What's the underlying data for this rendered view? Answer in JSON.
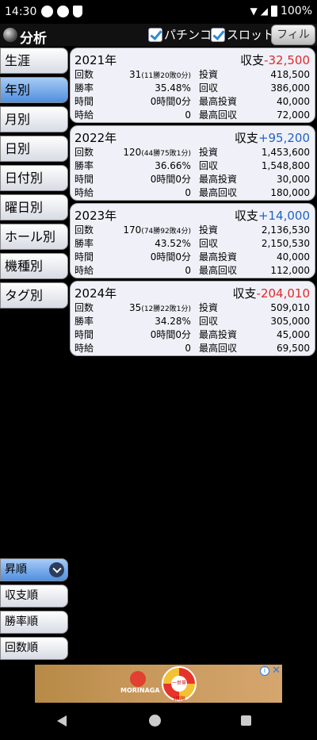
{
  "status": {
    "time": "14:30",
    "battery": "100%"
  },
  "header": {
    "title": "分析",
    "filter_pachinko": "パチンコ",
    "filter_slot": "スロット",
    "filter_button": "フィルタ"
  },
  "sidebar": {
    "items": [
      {
        "label": "生涯"
      },
      {
        "label": "年別"
      },
      {
        "label": "月別"
      },
      {
        "label": "日別"
      },
      {
        "label": "日付別"
      },
      {
        "label": "曜日別"
      },
      {
        "label": "ホール別"
      },
      {
        "label": "機種別"
      },
      {
        "label": "タグ別"
      }
    ],
    "active_index": 1
  },
  "sort": {
    "items": [
      {
        "label": "昇順"
      },
      {
        "label": "収支順"
      },
      {
        "label": "勝率順"
      },
      {
        "label": "回数順"
      }
    ]
  },
  "labels": {
    "balance": "収支",
    "count": "回数",
    "winrate": "勝率",
    "time": "時間",
    "hourly": "時給",
    "invest": "投資",
    "recover": "回収",
    "max_invest": "最高投資",
    "max_recover": "最高回収"
  },
  "cards": [
    {
      "year": "2021年",
      "balance": "-32,500",
      "balance_sign": "neg",
      "count": "31",
      "count_detail": "(11勝20敗0分)",
      "winrate": "35.48%",
      "time": "0時間0分",
      "hourly": "0",
      "invest": "418,500",
      "recover": "386,000",
      "max_invest": "40,000",
      "max_recover": "72,000"
    },
    {
      "year": "2022年",
      "balance": "+95,200",
      "balance_sign": "pos",
      "count": "120",
      "count_detail": "(44勝75敗1分)",
      "winrate": "36.66%",
      "time": "0時間0分",
      "hourly": "0",
      "invest": "1,453,600",
      "recover": "1,548,800",
      "max_invest": "30,000",
      "max_recover": "180,000"
    },
    {
      "year": "2023年",
      "balance": "+14,000",
      "balance_sign": "pos",
      "count": "170",
      "count_detail": "(74勝92敗4分)",
      "winrate": "43.52%",
      "time": "0時間0分",
      "hourly": "0",
      "invest": "2,136,530",
      "recover": "2,150,530",
      "max_invest": "40,000",
      "max_recover": "112,000"
    },
    {
      "year": "2024年",
      "balance": "-204,010",
      "balance_sign": "neg",
      "count": "35",
      "count_detail": "(12勝22敗1分)",
      "winrate": "34.28%",
      "time": "0時間0分",
      "hourly": "0",
      "invest": "509,010",
      "recover": "305,000",
      "max_invest": "45,000",
      "max_recover": "69,500"
    }
  ],
  "ad": {
    "brand": "MORINAGA",
    "wheel_text": "一世帯1回限り"
  },
  "icons": {
    "logo": "analysis-logo-icon",
    "check": "checkbox-checked-icon",
    "chevron": "chevron-down-icon"
  }
}
